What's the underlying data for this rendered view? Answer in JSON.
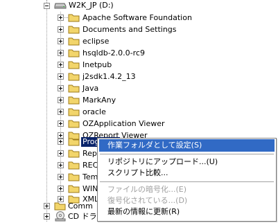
{
  "drive": {
    "label": "W2K_JP (D:)"
  },
  "folders": [
    "Apache Software Foundation",
    "Documents and Settings",
    "eclipse",
    "hsqldb-2.0.0-rc9",
    "Inetpub",
    "j2sdk1.4.2_13",
    "Java",
    "MarkAny",
    "oracle",
    "OZApplication Viewer",
    "OZReport Viewer",
    "Prog",
    "Rep",
    "REC",
    "Tem",
    "WIN",
    "XML"
  ],
  "bottom": [
    {
      "label": "Comm"
    },
    {
      "label": "CD ドラ"
    }
  ],
  "menu": {
    "items": [
      {
        "label": "作業フォルダとして設定(S)",
        "state": "highlighted"
      },
      {
        "label": "リポジトリにアップロード...(U)",
        "state": "normal"
      },
      {
        "label": "スクリプト比較...",
        "state": "normal"
      },
      {
        "label": "ファイルの暗号化...(E)",
        "state": "disabled"
      },
      {
        "label": "復号化されている...(D)",
        "state": "disabled"
      },
      {
        "label": "最新の情報に更新(R)",
        "state": "normal"
      }
    ]
  },
  "colors": {
    "selection": "#0a246a",
    "menu_highlight": "#316ac5",
    "folder": "#f2d56b"
  }
}
